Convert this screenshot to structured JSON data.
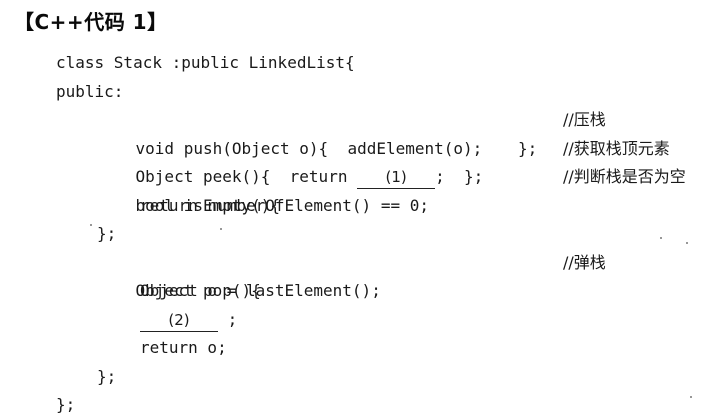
{
  "heading": "【C++代码 1】",
  "lines": {
    "l1": "class Stack :public LinkedList{",
    "l2": "public:",
    "l3a": "void push(Object o){  addElement(o);",
    "l3b": "};",
    "l3c": "//压栈",
    "l4a": "Object peek(){  return ",
    "l4blank": "(1)",
    "l4b": ";  };",
    "l4c": "//获取栈顶元素",
    "l5a": "bool isEmpty(){",
    "l5c": "//判断栈是否为空",
    "l6": "return numberOfElement() == 0;",
    "l7": "};",
    "l8a": "Object pop(){",
    "l8c": "//弹栈",
    "l9": "Object o = lastElement();",
    "l10blank": "(2)",
    "l10b": " ;",
    "l11": "return o;",
    "l12": "};",
    "l13": "};"
  }
}
